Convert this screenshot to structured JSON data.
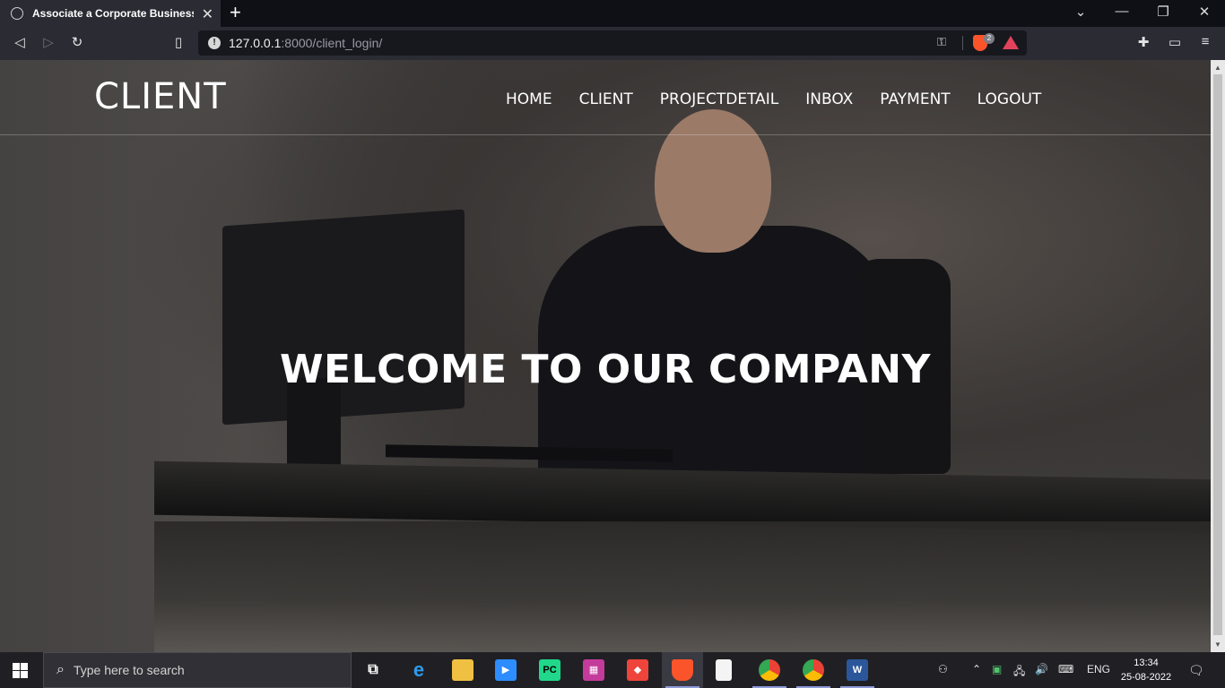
{
  "browser": {
    "tab_title": "Associate a Corporate Business C",
    "tab_close": "✕",
    "new_tab": "+",
    "url_host": "127.0.0.1",
    "url_rest": ":8000/client_login/",
    "shields_count": "2"
  },
  "site": {
    "logo": "CLIENT",
    "nav": [
      "HOME",
      "CLIENT",
      "PROJECTDETAIL",
      "INBOX",
      "PAYMENT",
      "LOGOUT"
    ],
    "hero_title": "WELCOME TO OUR COMPANY"
  },
  "taskbar": {
    "search_placeholder": "Type here to search",
    "apps": [
      "task-view",
      "edge",
      "file-explorer",
      "zoom",
      "pycharm",
      "jetbrains-toolbox",
      "anydesk",
      "brave",
      "notepad",
      "chrome",
      "chrome-profile",
      "word"
    ],
    "lang": "ENG",
    "time": "13:34",
    "date": "25-08-2022"
  },
  "colors": {
    "accent": "#8f9ad8",
    "brave": "#fb542b"
  }
}
